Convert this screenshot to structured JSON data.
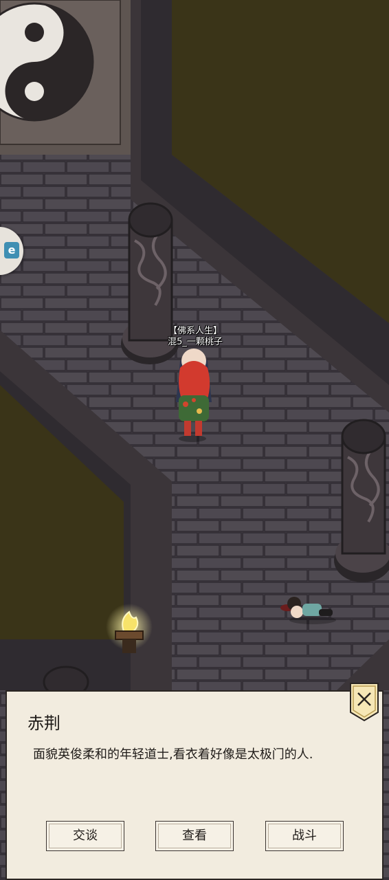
{
  "player": {
    "title": "【佛系人生】",
    "name": "混5_一颗桃子"
  },
  "side_tab": {
    "icon": "menu-tab-icon",
    "glyph": "e"
  },
  "dialog": {
    "title": "赤荆",
    "description": "面貌英俊柔和的年轻道士,看衣着好像是太极门的人.",
    "buttons": {
      "talk": "交谈",
      "inspect": "查看",
      "fight": "战斗"
    },
    "close_icon": "close-icon"
  },
  "colors": {
    "floor": "#4b454c",
    "brick_line": "#2d2a30",
    "void": "#3a3418",
    "wall": "#2f2b30",
    "panel": "#f2ecdf",
    "badge": "#f6e7b6"
  }
}
